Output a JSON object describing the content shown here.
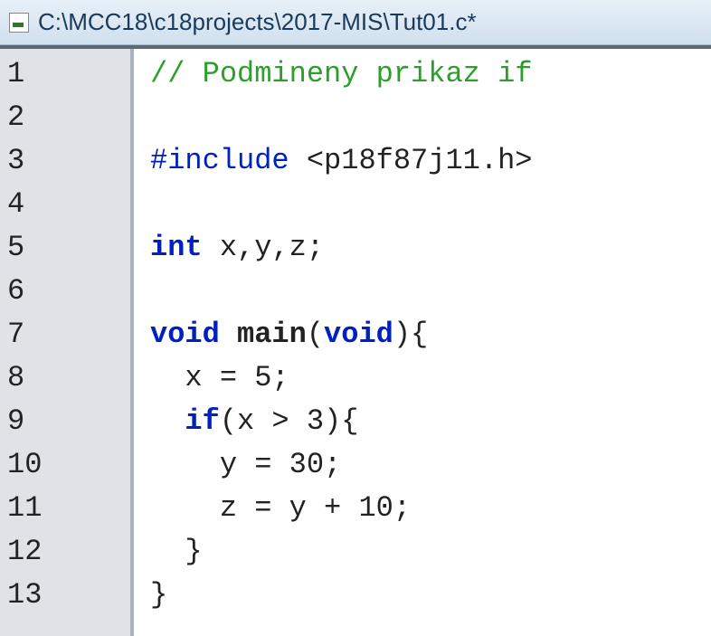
{
  "window": {
    "title": "C:\\MCC18\\c18projects\\2017-MIS\\Tut01.c*"
  },
  "editor": {
    "lines": [
      {
        "n": "1",
        "tokens": [
          {
            "cls": "s-comment",
            "t": "// Podmineny prikaz if"
          }
        ]
      },
      {
        "n": "2",
        "tokens": [
          {
            "cls": "",
            "t": ""
          }
        ]
      },
      {
        "n": "3",
        "tokens": [
          {
            "cls": "s-pre",
            "t": "#include"
          },
          {
            "cls": "",
            "t": " "
          },
          {
            "cls": "s-incfile",
            "t": "<p18f87j11.h>"
          }
        ]
      },
      {
        "n": "4",
        "tokens": [
          {
            "cls": "",
            "t": ""
          }
        ]
      },
      {
        "n": "5",
        "tokens": [
          {
            "cls": "s-keyword",
            "t": "int"
          },
          {
            "cls": "",
            "t": " x,y,z;"
          }
        ]
      },
      {
        "n": "6",
        "tokens": [
          {
            "cls": "",
            "t": ""
          }
        ]
      },
      {
        "n": "7",
        "tokens": [
          {
            "cls": "s-keyword",
            "t": "void"
          },
          {
            "cls": "",
            "t": " "
          },
          {
            "cls": "s-func",
            "t": "main"
          },
          {
            "cls": "",
            "t": "("
          },
          {
            "cls": "s-keyword",
            "t": "void"
          },
          {
            "cls": "",
            "t": "){"
          }
        ]
      },
      {
        "n": "8",
        "tokens": [
          {
            "cls": "",
            "t": "  x = 5;"
          }
        ]
      },
      {
        "n": "9",
        "tokens": [
          {
            "cls": "",
            "t": "  "
          },
          {
            "cls": "s-keyword",
            "t": "if"
          },
          {
            "cls": "",
            "t": "(x > 3){"
          }
        ]
      },
      {
        "n": "10",
        "tokens": [
          {
            "cls": "",
            "t": "    y = 30;"
          }
        ]
      },
      {
        "n": "11",
        "tokens": [
          {
            "cls": "",
            "t": "    z = y + 10;"
          }
        ]
      },
      {
        "n": "12",
        "tokens": [
          {
            "cls": "",
            "t": "  }"
          }
        ]
      },
      {
        "n": "13",
        "tokens": [
          {
            "cls": "",
            "t": "}"
          }
        ]
      }
    ]
  }
}
